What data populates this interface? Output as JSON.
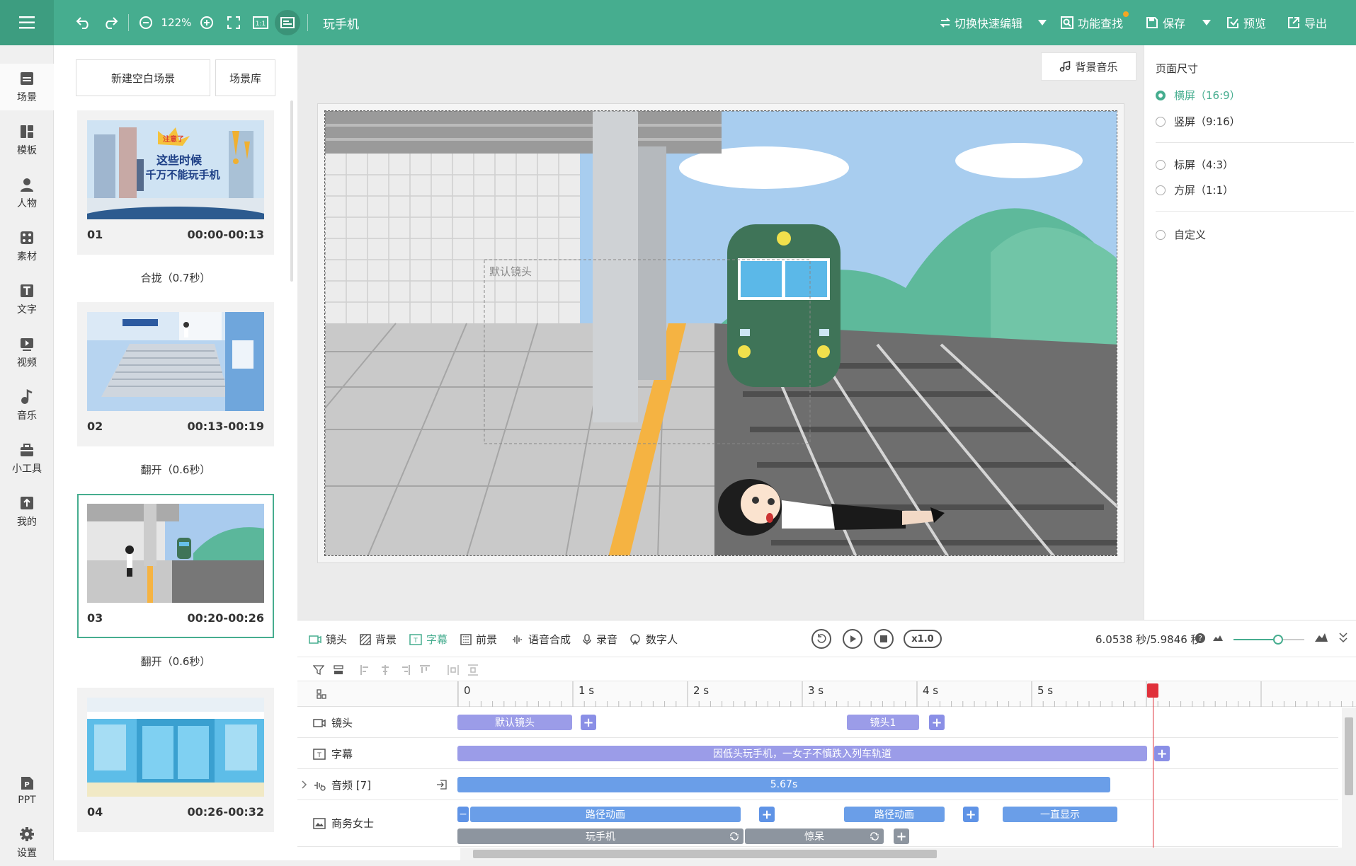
{
  "app": {
    "doc_title": "玩手机",
    "zoom": "122%",
    "toolbar": {
      "quick_edit": "切换快速编辑",
      "feature_search": "功能查找",
      "save": "保存",
      "preview": "预览",
      "export": "导出"
    }
  },
  "nav": [
    {
      "label": "场景",
      "icon": "scene-icon"
    },
    {
      "label": "模板",
      "icon": "template-icon"
    },
    {
      "label": "人物",
      "icon": "person-icon"
    },
    {
      "label": "素材",
      "icon": "material-icon"
    },
    {
      "label": "文字",
      "icon": "text-icon"
    },
    {
      "label": "视频",
      "icon": "video-icon"
    },
    {
      "label": "音乐",
      "icon": "music-icon"
    },
    {
      "label": "小工具",
      "icon": "toolbox-icon"
    },
    {
      "label": "我的",
      "icon": "upload-icon"
    },
    {
      "label": "PPT",
      "icon": "ppt-icon"
    },
    {
      "label": "设置",
      "icon": "gear-icon"
    }
  ],
  "scenes": {
    "new_blank": "新建空白场景",
    "library": "场景库",
    "items": [
      {
        "num": "01",
        "time": "00:00-00:13",
        "thumb_text_1": "注意了",
        "thumb_text_2": "这些时候",
        "thumb_text_3": "千万不能玩手机",
        "transition": "合拢（0.7秒）"
      },
      {
        "num": "02",
        "time": "00:13-00:19",
        "transition": "翻开（0.6秒）"
      },
      {
        "num": "03",
        "time": "00:20-00:26",
        "transition": "翻开（0.6秒）"
      },
      {
        "num": "04",
        "time": "00:26-00:32"
      }
    ]
  },
  "canvas": {
    "bgm": "背景音乐",
    "camera_label": "默认镜头"
  },
  "props": {
    "title": "页面尺寸",
    "options": [
      "横屏（16:9）",
      "竖屏（9:16）",
      "标屏（4:3）",
      "方屏（1:1）",
      "自定义"
    ],
    "selected": "横屏（16:9）"
  },
  "timeline": {
    "tabs": [
      "镜头",
      "背景",
      "字幕",
      "前景",
      "语音合成",
      "录音",
      "数字人"
    ],
    "active_tab": "字幕",
    "speed": "x1.0",
    "time_readout": "6.0538 秒/5.9846 秒",
    "ruler": [
      "0",
      "1 s",
      "2 s",
      "3 s",
      "4 s",
      "5 s"
    ],
    "tracks": {
      "camera": {
        "label": "镜头",
        "clips": [
          "默认镜头",
          "镜头1"
        ]
      },
      "subtitle": {
        "label": "字幕",
        "clips": [
          "因低头玩手机，一女子不慎跌入列车轨道"
        ]
      },
      "audio": {
        "label": "音频 [7]",
        "clips": [
          "5.67s"
        ]
      },
      "character": {
        "label": "商务女士",
        "anim_clips": [
          "路径动画",
          "路径动画",
          "一直显示"
        ],
        "action_clips": [
          "玩手机",
          "惊呆"
        ]
      }
    }
  },
  "colors": {
    "brand": "#46ad8f",
    "clip_purple": "#9b9ce8",
    "clip_blue": "#6a9ee8",
    "playhead": "#e0303a"
  }
}
